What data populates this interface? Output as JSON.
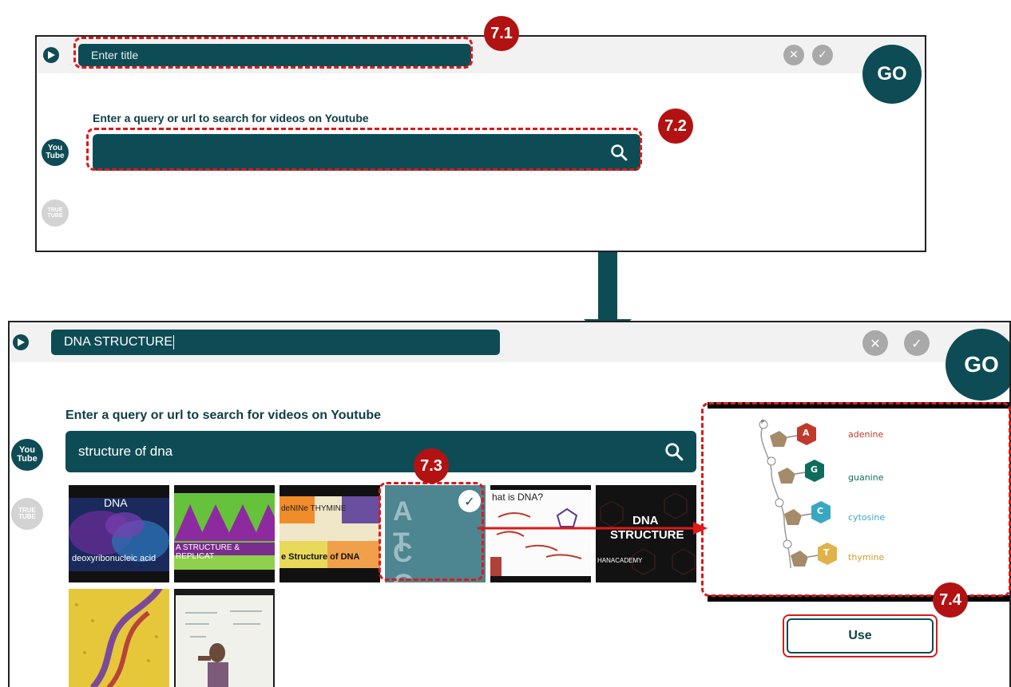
{
  "top_panel": {
    "title_placeholder": "Enter title",
    "go_label": "GO",
    "query_label": "Enter a query or url to search for videos on Youtube",
    "search_value": ""
  },
  "bottom_panel": {
    "title_value": "DNA STRUCTURE",
    "go_label": "GO",
    "query_label": "Enter a query or url to search for videos on Youtube",
    "search_value": "structure of dna",
    "use_label": "Use"
  },
  "sources": {
    "youtube_line1": "You",
    "youtube_line2": "Tube",
    "truetube_line1": "TRUE",
    "truetube_line2": "TUBE"
  },
  "thumbnails": [
    {
      "title": "DNA",
      "caption": "deoxyribonucleic acid"
    },
    {
      "title": "",
      "caption": "A STRUCTURE & REPLICAT"
    },
    {
      "title": "deNINe  THYMINE",
      "caption": "e Structure of DNA"
    },
    {
      "title": "A  T",
      "caption": "C  G"
    },
    {
      "title": "hat is DNA?",
      "caption": ""
    },
    {
      "title": "DNA",
      "caption": "STRUCTURE",
      "sub": "HANACADEMY"
    },
    {
      "title": "",
      "caption": ""
    },
    {
      "title": "",
      "caption": ""
    }
  ],
  "preview": {
    "bases": [
      "adenine",
      "guanine",
      "cytosine",
      "thymine"
    ],
    "base_letters": [
      "A",
      "G",
      "C",
      "T"
    ],
    "phosphate_label": "P"
  },
  "steps": {
    "s1": "7.1",
    "s2": "7.2",
    "s3": "7.3",
    "s4": "7.4"
  },
  "colors": {
    "brand": "#0e4c55",
    "callout": "#e01818",
    "badge": "#b31212",
    "adenine": "#c0392b",
    "guanine": "#0e6b5e",
    "cytosine": "#3aa7c2",
    "thymine": "#e0b24a"
  },
  "icons": [
    "logo-icon",
    "close-icon",
    "check-icon",
    "search-icon",
    "youtube-icon",
    "truetube-icon",
    "arrow-down-icon",
    "arrow-right-icon"
  ]
}
